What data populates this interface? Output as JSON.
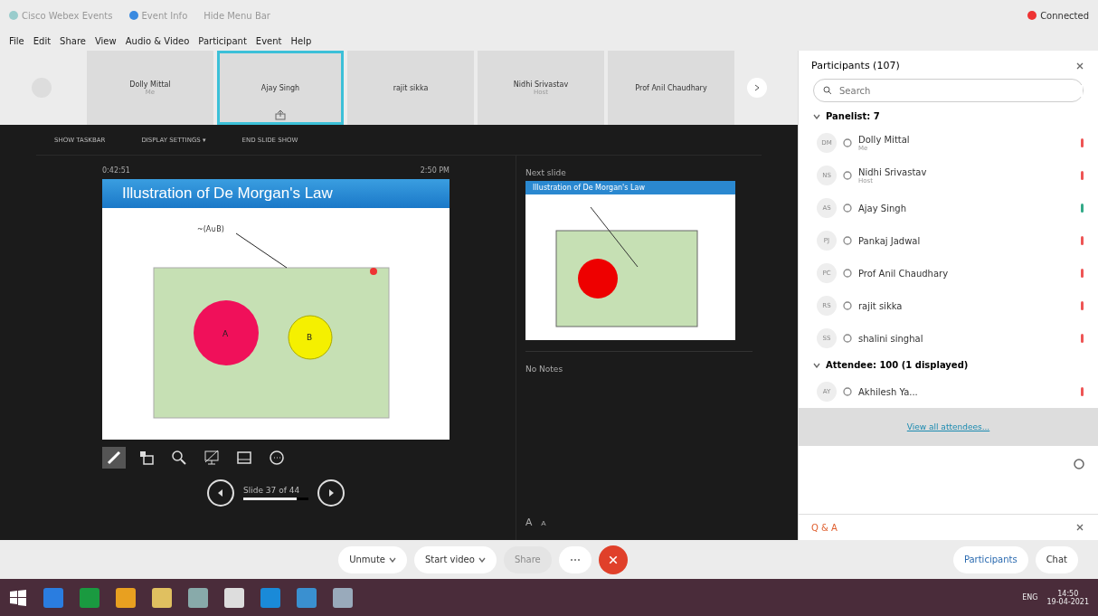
{
  "window": {
    "tabs": [
      {
        "label": "Cisco Webex Events"
      },
      {
        "label": "Event Info"
      },
      {
        "label": "Hide Menu Bar"
      }
    ],
    "status": "Connected"
  },
  "menu": [
    "File",
    "Edit",
    "Share",
    "View",
    "Audio & Video",
    "Participant",
    "Event",
    "Help"
  ],
  "thumbnails": [
    {
      "name": "Dolly Mittal",
      "role": "Me",
      "selected": false
    },
    {
      "name": "Ajay Singh",
      "selected": true
    },
    {
      "name": "rajit sikka",
      "selected": false
    },
    {
      "name": "Nidhi Srivastav",
      "role": "Host",
      "selected": false
    },
    {
      "name": "Prof Anil Chaudhary",
      "selected": false
    }
  ],
  "presenter": {
    "toolbar": [
      "SHOW TASKBAR",
      "DISPLAY SETTINGS ▾",
      "END SLIDE SHOW"
    ],
    "timer": "0:42:51",
    "clock": "2:50 PM",
    "slide_title": "Illustration of De Morgan's Law",
    "slide_label": "~(A∪B)",
    "circle_a": "A",
    "circle_b": "B",
    "next_label": "Next slide",
    "next_slide_title": "Illustration of De Morgan's Law",
    "notes": "No Notes",
    "slide_counter": "Slide 37 of 44",
    "progress": {
      "level": 0.82
    },
    "font_up": "A",
    "font_down": "A"
  },
  "participants": {
    "title": "Participants (107)",
    "search_placeholder": "Search",
    "sections": [
      {
        "title": "Panelist: 7",
        "expanded": true,
        "rows": [
          {
            "initials": "DM",
            "name": "Dolly Mittal",
            "role": "Me",
            "muted": true
          },
          {
            "initials": "NS",
            "name": "Nidhi Srivastav",
            "role": "Host",
            "muted": true
          },
          {
            "initials": "AS",
            "name": "Ajay Singh",
            "muted": false
          },
          {
            "initials": "PJ",
            "name": "Pankaj Jadwal",
            "muted": true
          },
          {
            "initials": "PC",
            "name": "Prof Anil Chaudhary",
            "muted": true
          },
          {
            "initials": "RS",
            "name": "rajit sikka",
            "muted": true
          },
          {
            "initials": "SS",
            "name": "shalini singhal",
            "muted": true
          }
        ]
      },
      {
        "title": "Attendee: 100 (1 displayed)",
        "expanded": true,
        "rows": [
          {
            "initials": "AY",
            "name": "Akhilesh Ya...",
            "muted": true
          }
        ]
      }
    ],
    "view_all": "View all attendees...",
    "qa": "Q & A"
  },
  "controls": {
    "unmute": "Unmute",
    "video": "Start video",
    "share": "Share",
    "share_disabled": true,
    "participants": "Participants",
    "chat": "Chat"
  },
  "taskbar": {
    "lang": "ENG",
    "time": "14:50",
    "date": "19-04-2021"
  }
}
